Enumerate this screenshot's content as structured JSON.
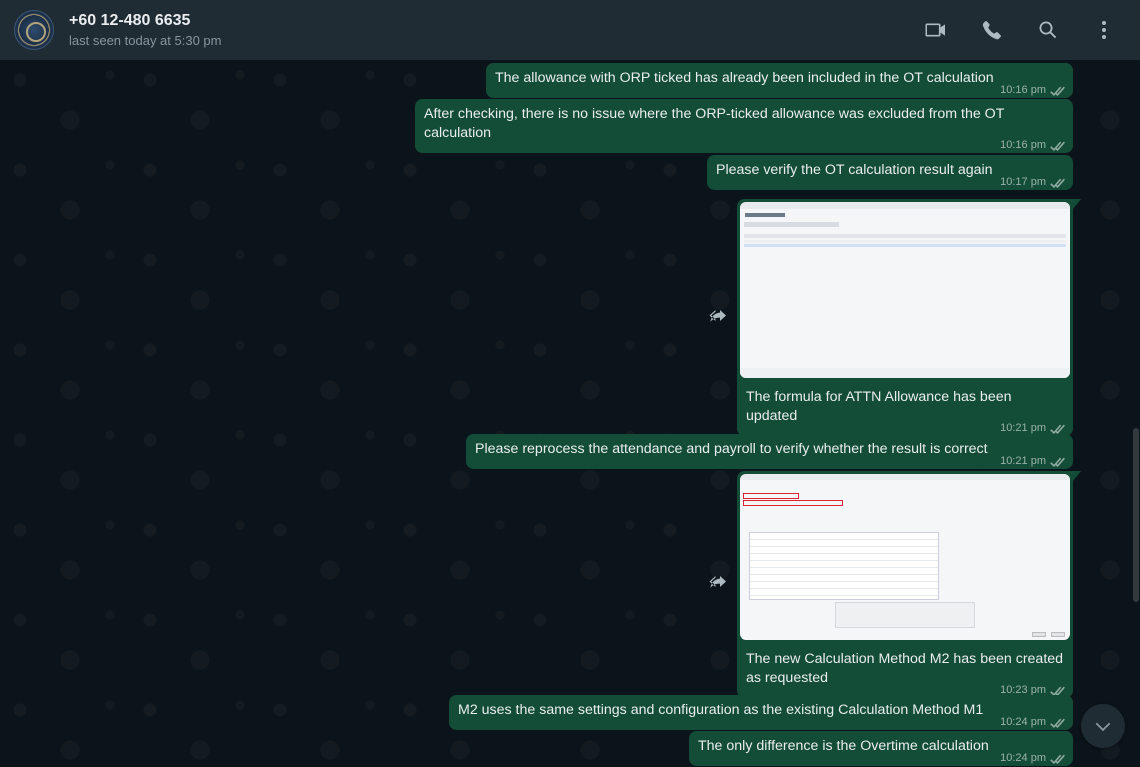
{
  "header": {
    "contact_name": "+60 12-480 6635",
    "status": "last seen today at 5:30 pm",
    "actions": [
      {
        "name": "video-call",
        "icon": "video-icon"
      },
      {
        "name": "voice-call",
        "icon": "phone-icon"
      },
      {
        "name": "search",
        "icon": "search-icon"
      },
      {
        "name": "menu",
        "icon": "kebab-menu-icon"
      }
    ]
  },
  "messages": [
    {
      "type": "text",
      "text": "The allowance with ORP ticked has already been included in the OT calculation",
      "time": "10:16 pm"
    },
    {
      "type": "text",
      "text": "After checking, there is no issue where the ORP-ticked allowance was excluded from the OT calculation",
      "time": "10:16 pm"
    },
    {
      "type": "text",
      "text": "Please verify the OT calculation result again",
      "time": "10:17 pm"
    },
    {
      "type": "image",
      "image_title": "Payroll Formula",
      "caption": "The formula for ATTN Allowance has been updated",
      "time": "10:21 pm"
    },
    {
      "type": "text",
      "text": "Please reprocess the attendance and payroll to verify whether the result is correct",
      "time": "10:21 pm"
    },
    {
      "type": "image",
      "image_title": "Edit - Calculation Method M2",
      "caption": "The new Calculation Method M2 has been created as requested",
      "time": "10:23 pm"
    },
    {
      "type": "text",
      "text": "M2 uses the same settings and configuration as the existing Calculation Method M1",
      "time": "10:24 pm"
    },
    {
      "type": "text",
      "text": "The only difference is the Overtime calculation",
      "time": "10:24 pm"
    }
  ],
  "colors": {
    "header_bg": "#202c33",
    "chat_bg": "#0b141a",
    "outgoing_bubble": "#144d37",
    "text_primary": "#e9edef",
    "text_secondary": "#8696a0"
  }
}
